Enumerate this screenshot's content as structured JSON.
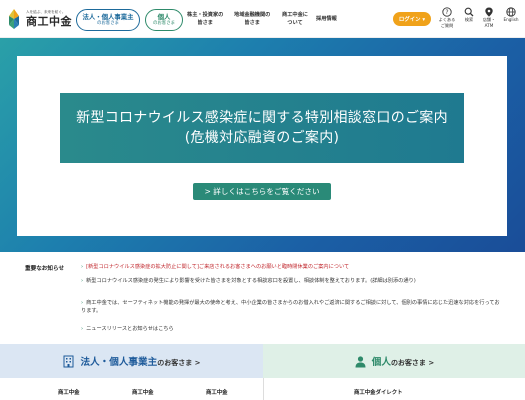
{
  "header": {
    "logo_small": "人を結ぶ、未来を紡ぐ。",
    "logo_main": "商工中金",
    "pill_corporate_title": "法人・個人事業主",
    "pill_corporate_sub": "のお客さま",
    "pill_individual_title": "個人",
    "pill_individual_sub": "のお客さま",
    "nav_investors": [
      "株主・投資家の",
      "皆さま"
    ],
    "nav_financial": [
      "地域金融機関の",
      "皆さま"
    ],
    "nav_about": [
      "商工中金に",
      "ついて"
    ],
    "nav_recruit": "採用情報",
    "login_label": "ログイン ▾",
    "util_faq": [
      "よくある",
      "ご質問"
    ],
    "util_search": "検索",
    "util_branch": [
      "店舗・",
      "ATM"
    ],
    "util_english": "English"
  },
  "hero": {
    "title_line1": "新型コロナウイルス感染症に関する特別相談窓口のご案内",
    "title_line2": "(危機対応融資のご案内)",
    "button_label": "> 詳しくはこちらをご覧ください"
  },
  "notices": {
    "label": "重要なお知らせ",
    "items": [
      "[新型コロナウイルス感染症の拡大防止に関して]ご来店されるお客さまへのお願いと臨時閉休業のご案内について",
      "新型コロナウイルス感染症の発生により影響を受けた皆さまを対象とする相談窓口を設置し、相談体制を整えております。(詳細は別添の通り)",
      "商工中金では、セーフティネット機能の発揮が最大の使命と考え、中小企業の皆さまからのお借入れやご返済に関するご相談に対して、個別の事情に応じた迅速な対応を行っております。",
      "ニュースリリースとお知らせはこちら"
    ]
  },
  "tabs": {
    "corporate_title": "法人・個人事業主",
    "corporate_suffix": "のお客さま >",
    "individual_title": "個人",
    "individual_suffix": "のお客さま >"
  },
  "bottom": {
    "col1": "商工中金",
    "col2": "商工中金",
    "col3": "商工中金",
    "col4": "商工中金ダイレクト"
  },
  "colors": {
    "brand_blue": "#1d6a9b",
    "brand_green": "#2e8a6a",
    "login_orange": "#f0a21a",
    "alert_red": "#c0262c"
  }
}
